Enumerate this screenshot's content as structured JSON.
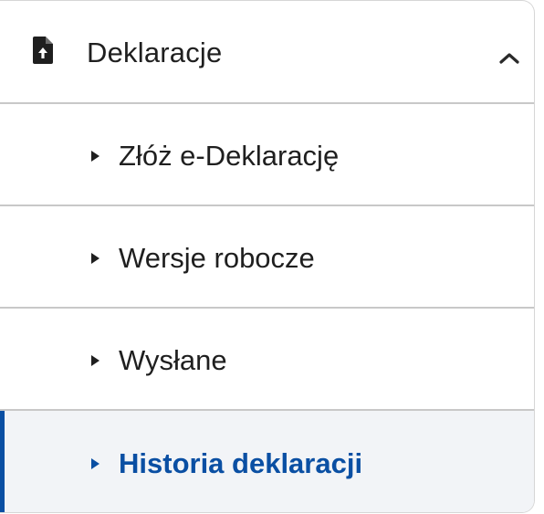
{
  "menu": {
    "header": {
      "label": "Deklaracje",
      "icon": "document-upload-icon",
      "toggle_icon": "chevron-up-icon",
      "expanded": true
    },
    "items": [
      {
        "label": "Złóż e-Deklarację",
        "active": false
      },
      {
        "label": "Wersje robocze",
        "active": false
      },
      {
        "label": "Wysłane",
        "active": false
      },
      {
        "label": "Historia deklaracji",
        "active": true
      }
    ]
  },
  "colors": {
    "accent": "#0a4fa3",
    "text": "#1f1f1f",
    "divider": "#c8c8c8",
    "active_background": "#f2f4f7"
  }
}
